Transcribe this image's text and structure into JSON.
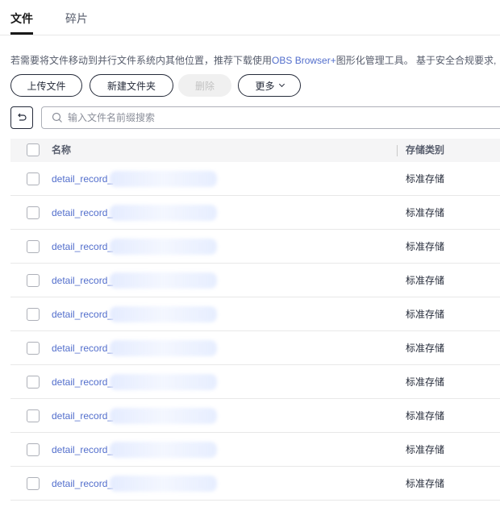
{
  "tabs": [
    {
      "label": "文件",
      "active": true
    },
    {
      "label": "碎片",
      "active": false
    }
  ],
  "notice": {
    "prefix": "若需要将文件移动到并行文件系统内其他位置，推荐下载使用",
    "link": "OBS Browser+",
    "suffix": "图形化管理工具。 基于安全合规要求,"
  },
  "toolbar": {
    "upload": "上传文件",
    "new_folder": "新建文件夹",
    "delete": "删除",
    "more": "更多"
  },
  "search": {
    "placeholder": "输入文件名前缀搜索"
  },
  "table": {
    "columns": {
      "name": "名称",
      "storage": "存储类别"
    },
    "rows": [
      {
        "name": "detail_record_",
        "storage": "标准存储"
      },
      {
        "name": "detail_record_",
        "storage": "标准存储"
      },
      {
        "name": "detail_record_",
        "storage": "标准存储"
      },
      {
        "name": "detail_record_",
        "storage": "标准存储"
      },
      {
        "name": "detail_record_",
        "storage": "标准存储"
      },
      {
        "name": "detail_record_",
        "storage": "标准存储"
      },
      {
        "name": "detail_record_",
        "storage": "标准存储"
      },
      {
        "name": "detail_record_",
        "storage": "标准存储"
      },
      {
        "name": "detail_record_",
        "storage": "标准存储"
      },
      {
        "name": "detail_record_",
        "storage": "标准存储"
      }
    ]
  },
  "icons": {
    "back": "back-arrow-icon",
    "search": "search-icon",
    "more": "chevron-down-icon"
  },
  "colors": {
    "link": "#526ecc",
    "text": "#252b3a",
    "header_bg": "#f5f5f6",
    "disabled_bg": "#f0f0f0"
  }
}
